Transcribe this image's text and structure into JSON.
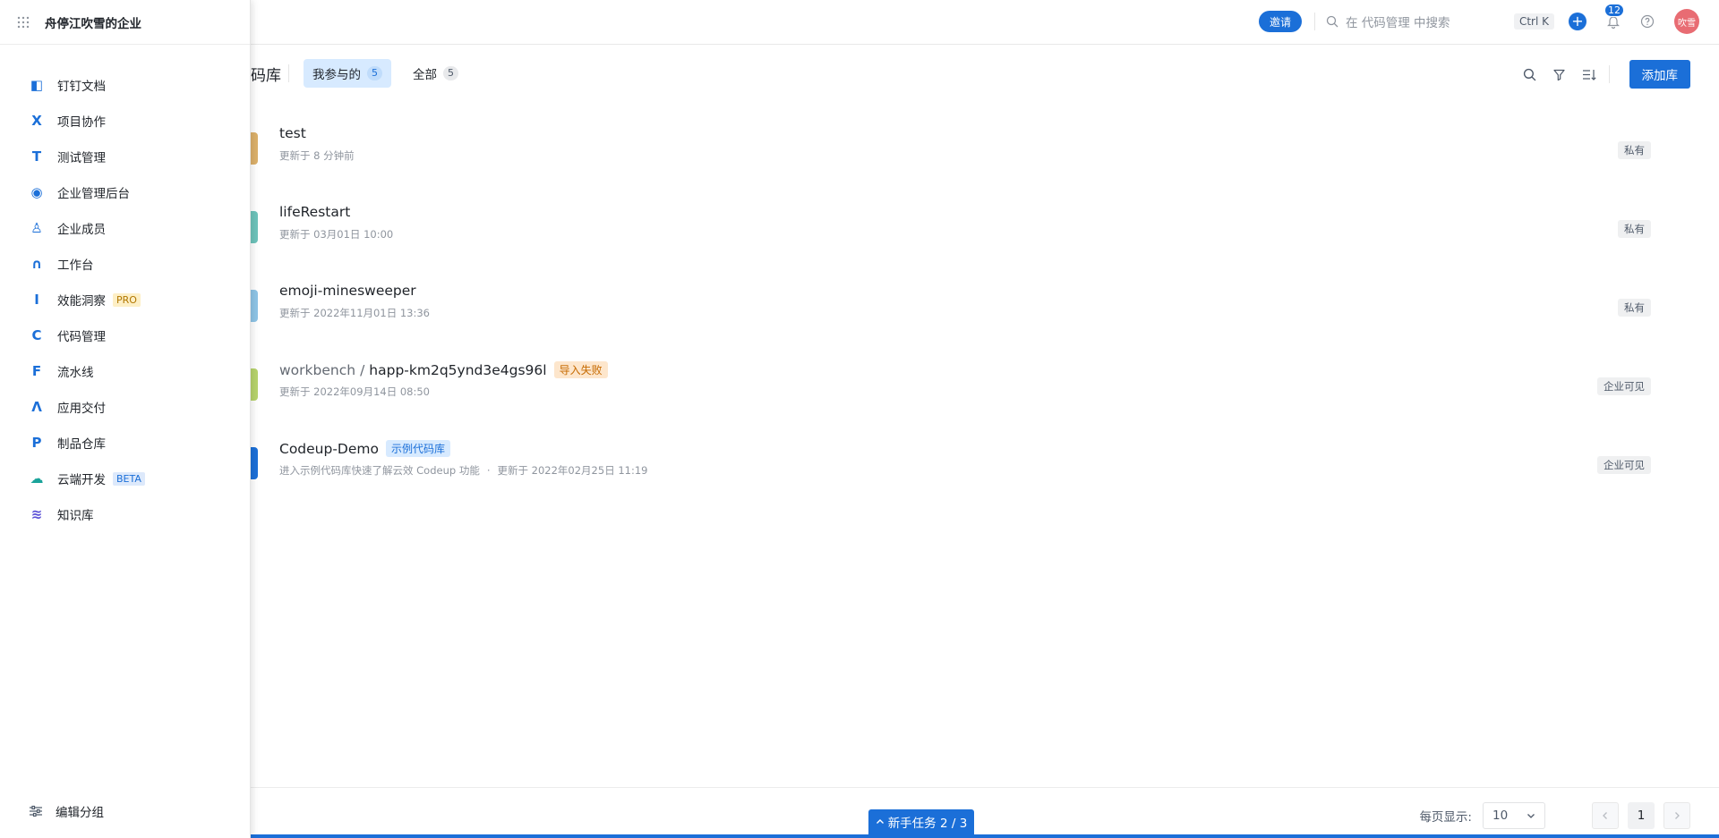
{
  "topbar": {
    "invite_label": "邀请",
    "search_placeholder": "在 代码管理 中搜索",
    "shortcut": "Ctrl K",
    "notification_count": "12",
    "avatar_text": "吹雪"
  },
  "header": {
    "title_partial": "码库",
    "tabs": [
      {
        "label": "我参与的",
        "count": "5"
      },
      {
        "label": "全部",
        "count": "5"
      }
    ],
    "add_label": "添加库"
  },
  "repos": [
    {
      "name": "test",
      "meta": "更新于 8 分钟前",
      "visibility": "私有",
      "color": "#dcb06a"
    },
    {
      "name": "lifeRestart",
      "meta": "更新于 03月01日 10:00",
      "visibility": "私有",
      "color": "#6dc3bb"
    },
    {
      "name": "emoji-minesweeper",
      "meta": "更新于 2022年11月01日 13:36",
      "visibility": "私有",
      "color": "#8ec4e6"
    },
    {
      "namespace": "workbench",
      "separator": "/",
      "name": "happ-km2q5ynd3e4gs96l",
      "tag": "导入失败",
      "meta": "更新于 2022年09月14日 08:50",
      "visibility": "企业可见",
      "color": "#b7d36c"
    },
    {
      "name": "Codeup-Demo",
      "tag": "示例代码库",
      "meta_prefix": "进入示例代码库快速了解云效 Codeup 功能",
      "meta_dot": "·",
      "meta": "更新于 2022年02月25日 11:19",
      "visibility": "企业可见",
      "color": "#1b6fd8"
    }
  ],
  "footer": {
    "page_size_label": "每页显示:",
    "page_size": "10",
    "current_page": "1",
    "task_label": "新手任务 2 / 3"
  },
  "sidebar": {
    "org_name": "舟停江吹雪的企业",
    "items": [
      {
        "label": "钉钉文档",
        "icon": "dingtalk-doc-icon",
        "color": "#1b6fd8"
      },
      {
        "label": "项目协作",
        "icon": "project-icon",
        "color": "#1b6fd8"
      },
      {
        "label": "测试管理",
        "icon": "test-icon",
        "color": "#1b6fd8"
      },
      {
        "label": "企业管理后台",
        "icon": "admin-icon",
        "color": "#1b6fd8"
      },
      {
        "label": "企业成员",
        "icon": "members-icon",
        "color": "#1b6fd8"
      },
      {
        "label": "工作台",
        "icon": "workbench-icon",
        "color": "#1b6fd8"
      },
      {
        "label": "效能洞察",
        "icon": "insight-icon",
        "color": "#1b6fd8",
        "badge": "PRO"
      },
      {
        "label": "代码管理",
        "icon": "code-icon",
        "color": "#1b6fd8"
      },
      {
        "label": "流水线",
        "icon": "pipeline-icon",
        "color": "#1b6fd8"
      },
      {
        "label": "应用交付",
        "icon": "delivery-icon",
        "color": "#1b6fd8"
      },
      {
        "label": "制品仓库",
        "icon": "artifact-icon",
        "color": "#1b6fd8"
      },
      {
        "label": "云端开发",
        "icon": "cloud-dev-icon",
        "color": "#1aa39a",
        "badge": "BETA"
      },
      {
        "label": "知识库",
        "icon": "knowledge-icon",
        "color": "#5a4fd6"
      }
    ],
    "edit_group_label": "编辑分组"
  }
}
